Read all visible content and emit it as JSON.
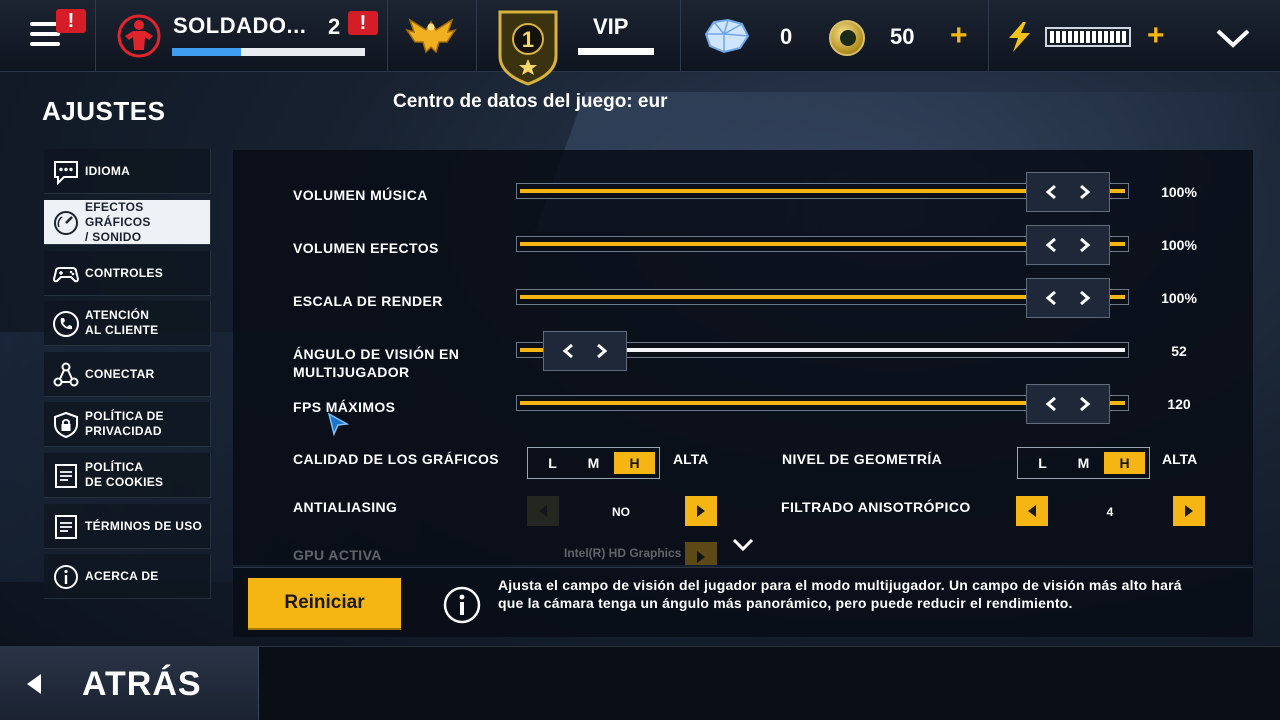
{
  "topbar": {
    "alert_glyph": "!",
    "soldier_name": "SOLDADO...",
    "soldier_level": "2",
    "xp_progress": 0.36,
    "vip_rank": "1",
    "vip_label": "VIP",
    "diamonds": "0",
    "coins": "50",
    "plus": "+",
    "energy_segments": 13
  },
  "settings": {
    "title": "AJUSTES",
    "data_center": "Centro de datos del juego: eur"
  },
  "sidebar": {
    "items": [
      {
        "label": "IDIOMA",
        "icon": "chat-bubble-icon"
      },
      {
        "label": "EFECTOS\nGRÁFICOS\n/ SONIDO",
        "icon": "gauge-icon",
        "active": true
      },
      {
        "label": "CONTROLES",
        "icon": "gamepad-icon"
      },
      {
        "label": "ATENCIÓN\nAL CLIENTE",
        "icon": "phone-icon"
      },
      {
        "label": "CONECTAR",
        "icon": "share-network-icon"
      },
      {
        "label": "POLÍTICA DE\nPRIVACIDAD",
        "icon": "shield-lock-icon"
      },
      {
        "label": "POLÍTICA\nDE COOKIES",
        "icon": "document-icon"
      },
      {
        "label": "TÉRMINOS DE USO",
        "icon": "document-icon"
      },
      {
        "label": "ACERCA DE",
        "icon": "info-circle-icon"
      }
    ]
  },
  "sliders": [
    {
      "label": "VOLUMEN MÚSICA",
      "value": "100%",
      "level": 1.0
    },
    {
      "label": "VOLUMEN EFECTOS",
      "value": "100%",
      "level": 1.0
    },
    {
      "label": "ESCALA DE RENDER",
      "value": "100%",
      "level": 1.0
    },
    {
      "label": "ÁNGULO DE VISIÓN EN\nMULTIJUGADOR",
      "value": "52",
      "level": 0.04
    },
    {
      "label": "FPS MÁXIMOS",
      "value": "120",
      "level": 1.0
    }
  ],
  "graphics_quality": {
    "label": "CALIDAD DE LOS GRÁFICOS",
    "options": [
      "L",
      "M",
      "H"
    ],
    "selected": "H",
    "value": "ALTA"
  },
  "geometry_level": {
    "label": "NIVEL DE GEOMETRÍA",
    "options": [
      "L",
      "M",
      "H"
    ],
    "selected": "H",
    "value": "ALTA"
  },
  "antialiasing": {
    "label": "ANTIALIASING",
    "value": "NO"
  },
  "anisotropic": {
    "label": "FILTRADO ANISOTRÓPICO",
    "value": "4"
  },
  "gpu": {
    "label": "GPU ACTIVA",
    "value": "Intel(R) HD Graphics"
  },
  "info": {
    "reset_label": "Reiniciar",
    "text": "Ajusta el campo de visión del jugador para el modo multijugador. Un campo de visión más alto hará que la cámara tenga un ángulo más panorámico, pero puede reducir el rendimiento."
  },
  "back_label": "ATRÁS",
  "colors": {
    "accent": "#f5b512",
    "alert": "#d41d26",
    "xp": "#3f9ef0"
  }
}
